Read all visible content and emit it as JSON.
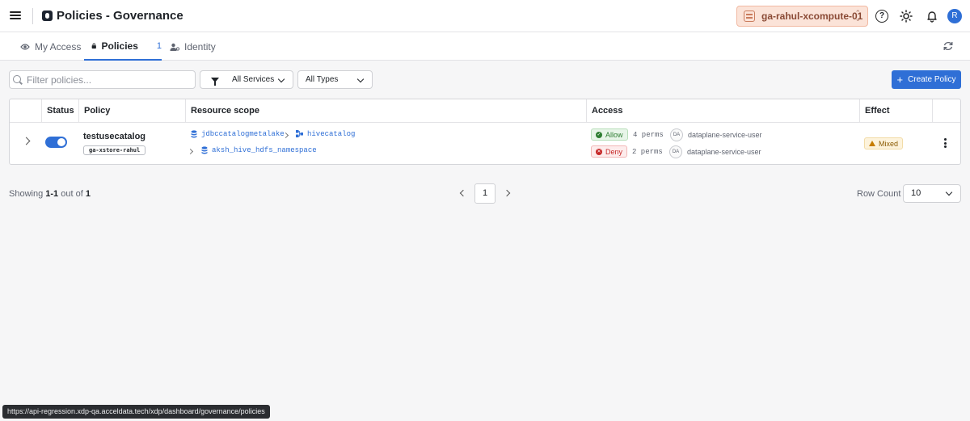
{
  "app": {
    "title": "Policies - Governance"
  },
  "header": {
    "environment": "ga-rahul-xcompute-01",
    "avatar_initial": "R",
    "help_icon": "help-icon",
    "theme_icon": "sun-icon",
    "notifications_icon": "bell-icon"
  },
  "tabs": [
    {
      "label": "My Access",
      "icon": "eye-icon"
    },
    {
      "label": "Policies",
      "icon": "lock-icon",
      "count": "1",
      "active": true
    },
    {
      "label": "Identity",
      "icon": "user-gear-icon"
    }
  ],
  "filters": {
    "search_placeholder": "Filter policies...",
    "services": "All Services",
    "types": "All Types",
    "create_label": "Create Policy"
  },
  "table": {
    "headers": [
      "Status",
      "Policy",
      "Resource scope",
      "Access",
      "Effect"
    ],
    "rows": [
      {
        "enabled": true,
        "name": "testusecatalog",
        "tag": "ga-xstore-rahul",
        "scope": {
          "metalake": "jdbccatalogmetalake",
          "catalog": "hivecatalog",
          "namespace": "aksh_hive_hdfs_namespace"
        },
        "access": [
          {
            "effect": "Allow",
            "perms": "4 perms",
            "initials": "DA",
            "user": "dataplane-service-user"
          },
          {
            "effect": "Deny",
            "perms": "2 perms",
            "initials": "DA",
            "user": "dataplane-service-user"
          }
        ],
        "effect": "Mixed"
      }
    ]
  },
  "pagination": {
    "showing_prefix": "Showing",
    "range": "1-1",
    "out_of": "out of",
    "total": "1",
    "current_page": "1",
    "row_count_label": "Row Count",
    "row_count": "10"
  },
  "status_url": "https://api-regression.xdp-qa.acceldata.tech/xdp/dashboard/governance/policies",
  "colors": {
    "accent": "#2f6fd6",
    "allow": "#2e7d32",
    "deny": "#c62828",
    "env_bg": "#fbe3d8"
  }
}
